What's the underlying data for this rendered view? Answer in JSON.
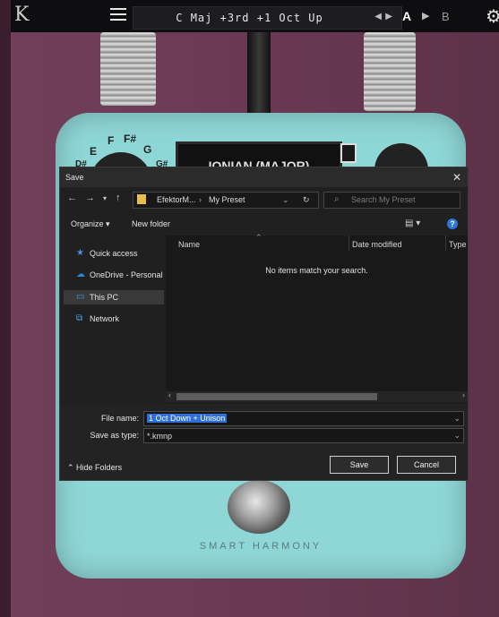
{
  "plugin": {
    "logo": "K",
    "preset_name": "C Maj +3rd +1 Oct Up",
    "ab_a": "A",
    "ab_b": "B",
    "display_text": "IONIAN (MAJOR)",
    "notes": [
      "E",
      "F",
      "F#",
      "G",
      "D#",
      "G#"
    ],
    "brand": "SMART HARMONY",
    "pedal_color": "#8fd6d6"
  },
  "icons": {
    "menu": "hamburger-icon",
    "settings": "gear-icon",
    "folder": "folder-icon",
    "search": "search-icon"
  },
  "dialog": {
    "title": "Save",
    "breadcrumb": [
      "EfektorM...",
      "My Preset"
    ],
    "search_placeholder": "Search My Preset",
    "organize": "Organize ▾",
    "new_folder": "New folder",
    "nav_items": [
      "Quick access",
      "OneDrive - Personal",
      "This PC",
      "Network"
    ],
    "columns": [
      "Name",
      "Date modified",
      "Type"
    ],
    "empty_message": "No items match your search.",
    "file_name_label": "File name:",
    "file_name_value": "1 Oct Down + Unison",
    "save_as_label": "Save as type:",
    "save_as_value": "*.kmnp",
    "hide_folders": "Hide Folders",
    "save_button": "Save",
    "cancel_button": "Cancel"
  }
}
